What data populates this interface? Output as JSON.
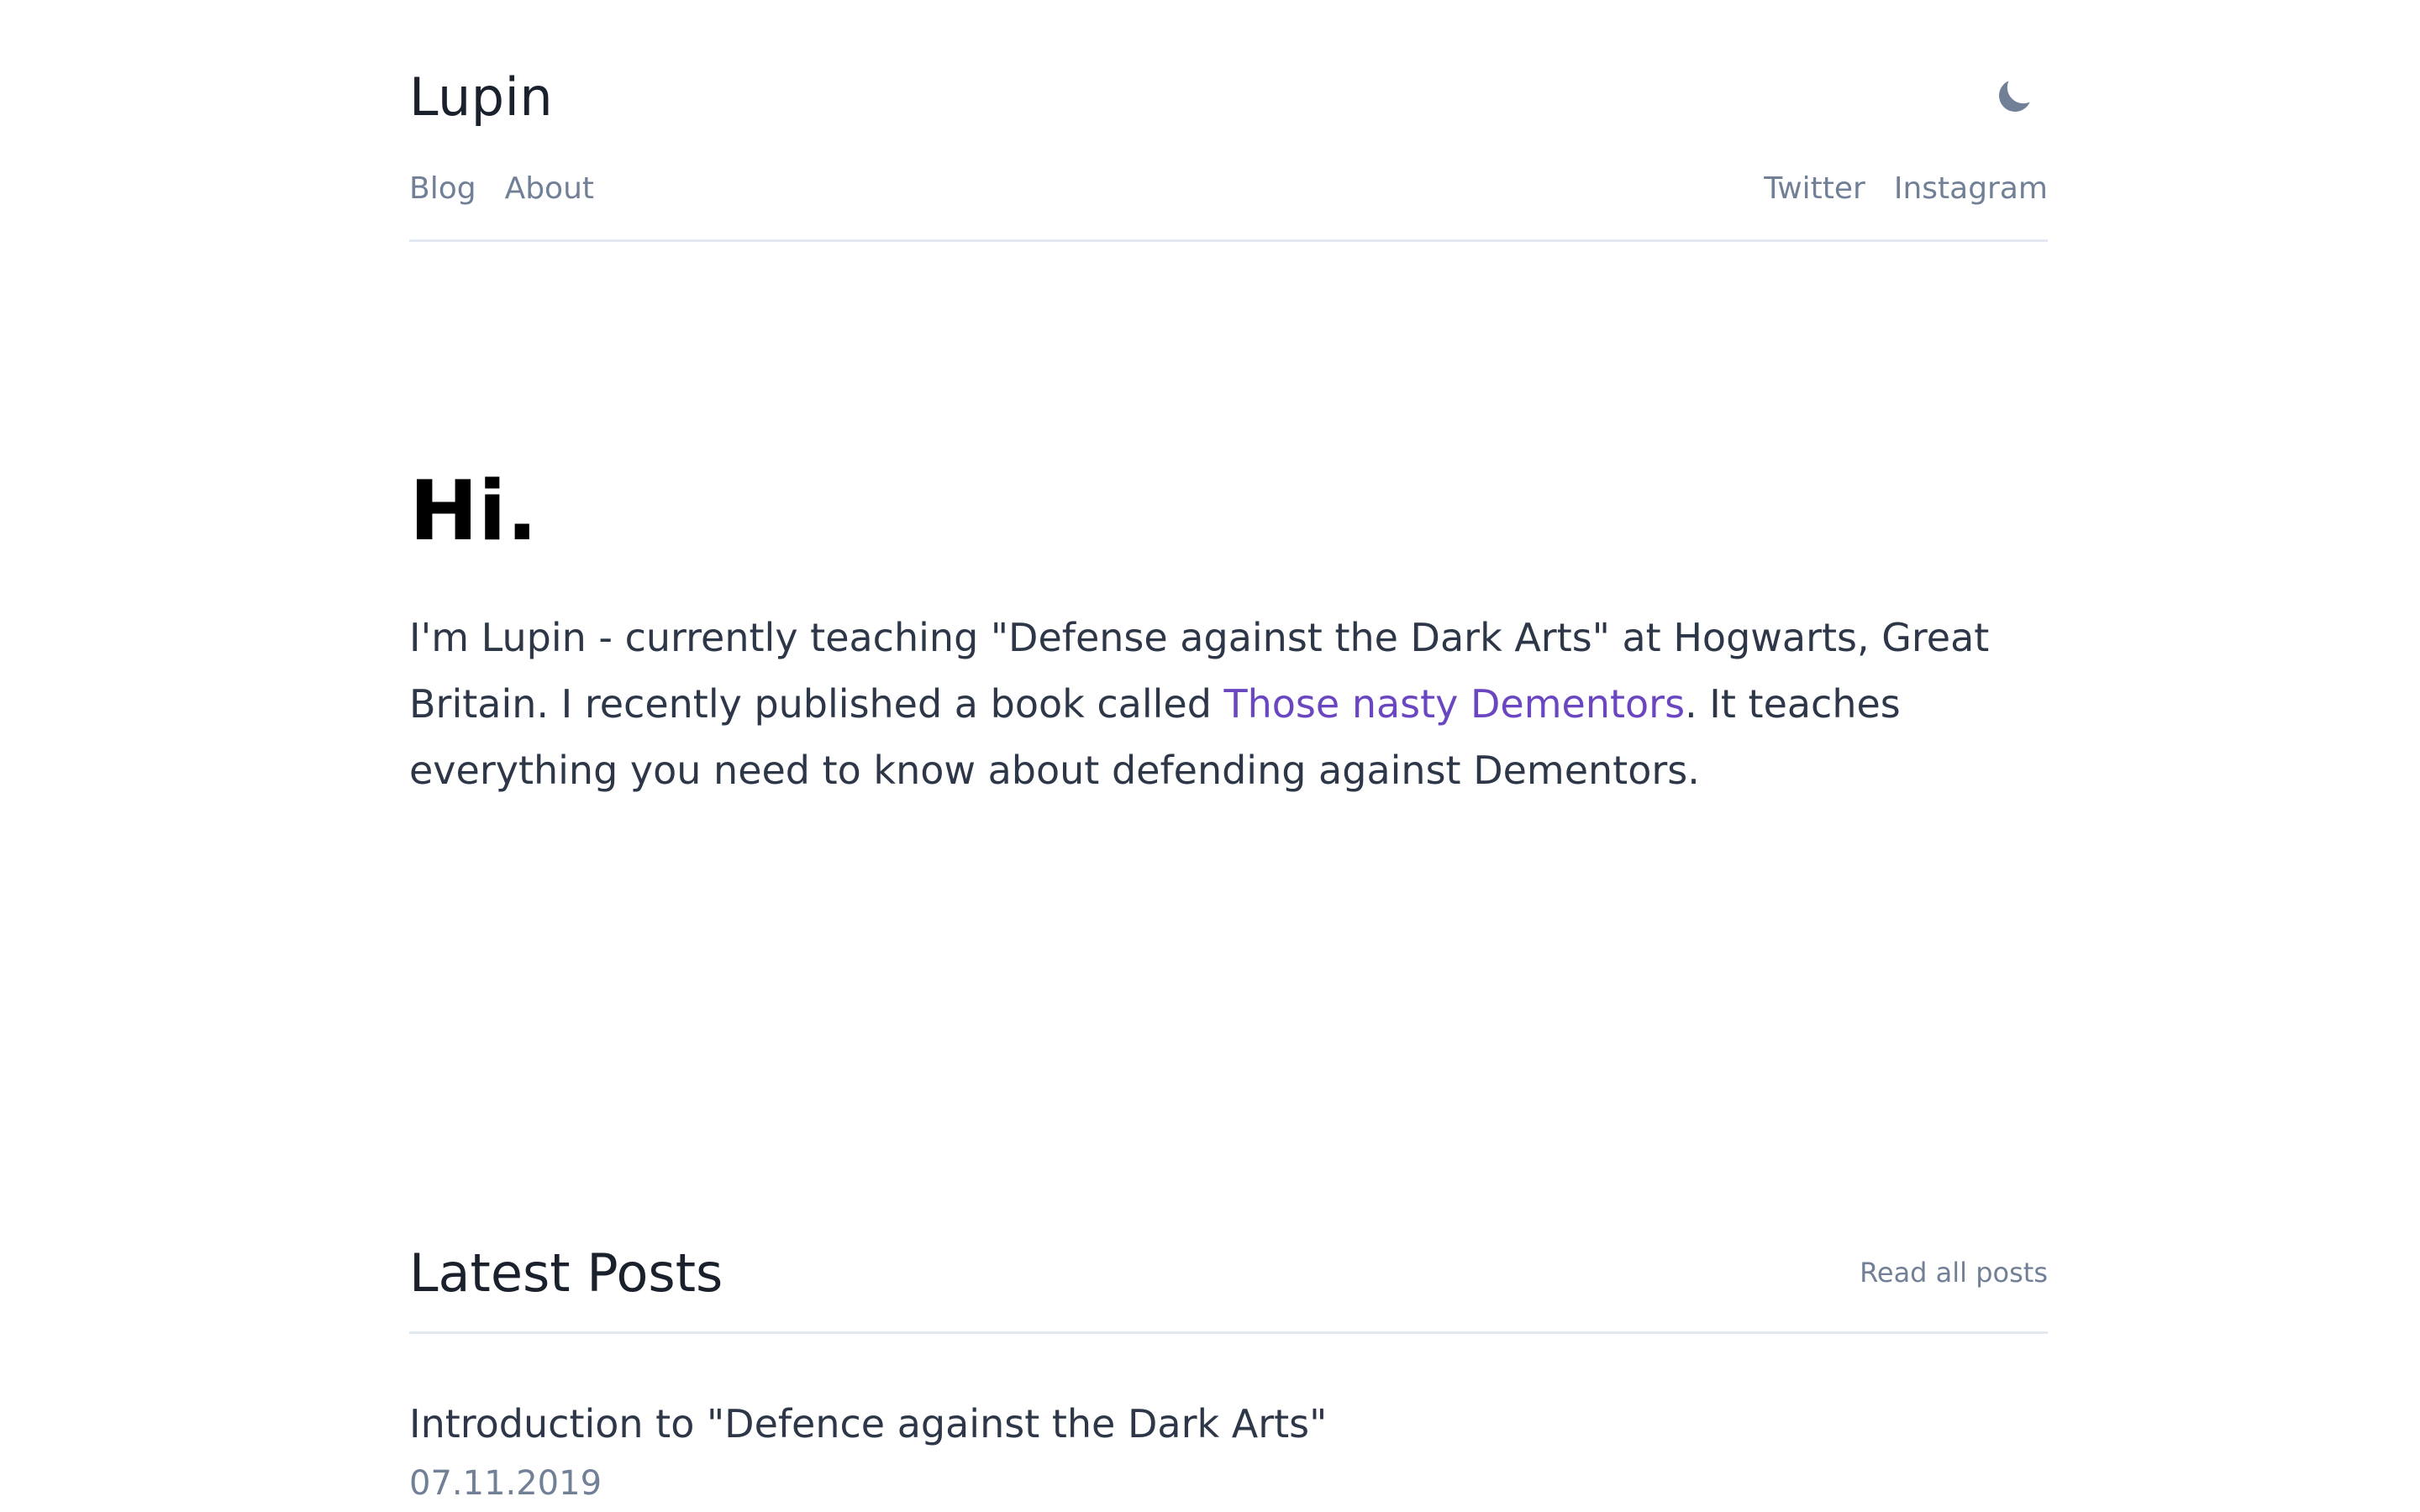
{
  "site": {
    "title": "Lupin",
    "theme_toggle_icon": "moon-icon"
  },
  "nav": {
    "left": [
      {
        "label": "Blog"
      },
      {
        "label": "About"
      }
    ],
    "right": [
      {
        "label": "Twitter"
      },
      {
        "label": "Instagram"
      }
    ]
  },
  "hero": {
    "title": "Hi.",
    "text_before_link": "I'm Lupin - currently teaching \"Defense against the Dark Arts\" at Hogwarts, Great Britain. I recently published a book called ",
    "link_text": "Those nasty Dementors",
    "text_after_link": ". It teaches everything you need to know about defending against Dementors."
  },
  "latest": {
    "title": "Latest Posts",
    "read_all": "Read all posts",
    "posts": [
      {
        "title": "Introduction to \"Defence against the Dark Arts\"",
        "date": "07.11.2019"
      }
    ]
  },
  "colors": {
    "accent_link": "#6b46c1",
    "muted": "#718096",
    "divider": "#e2e8f0"
  }
}
